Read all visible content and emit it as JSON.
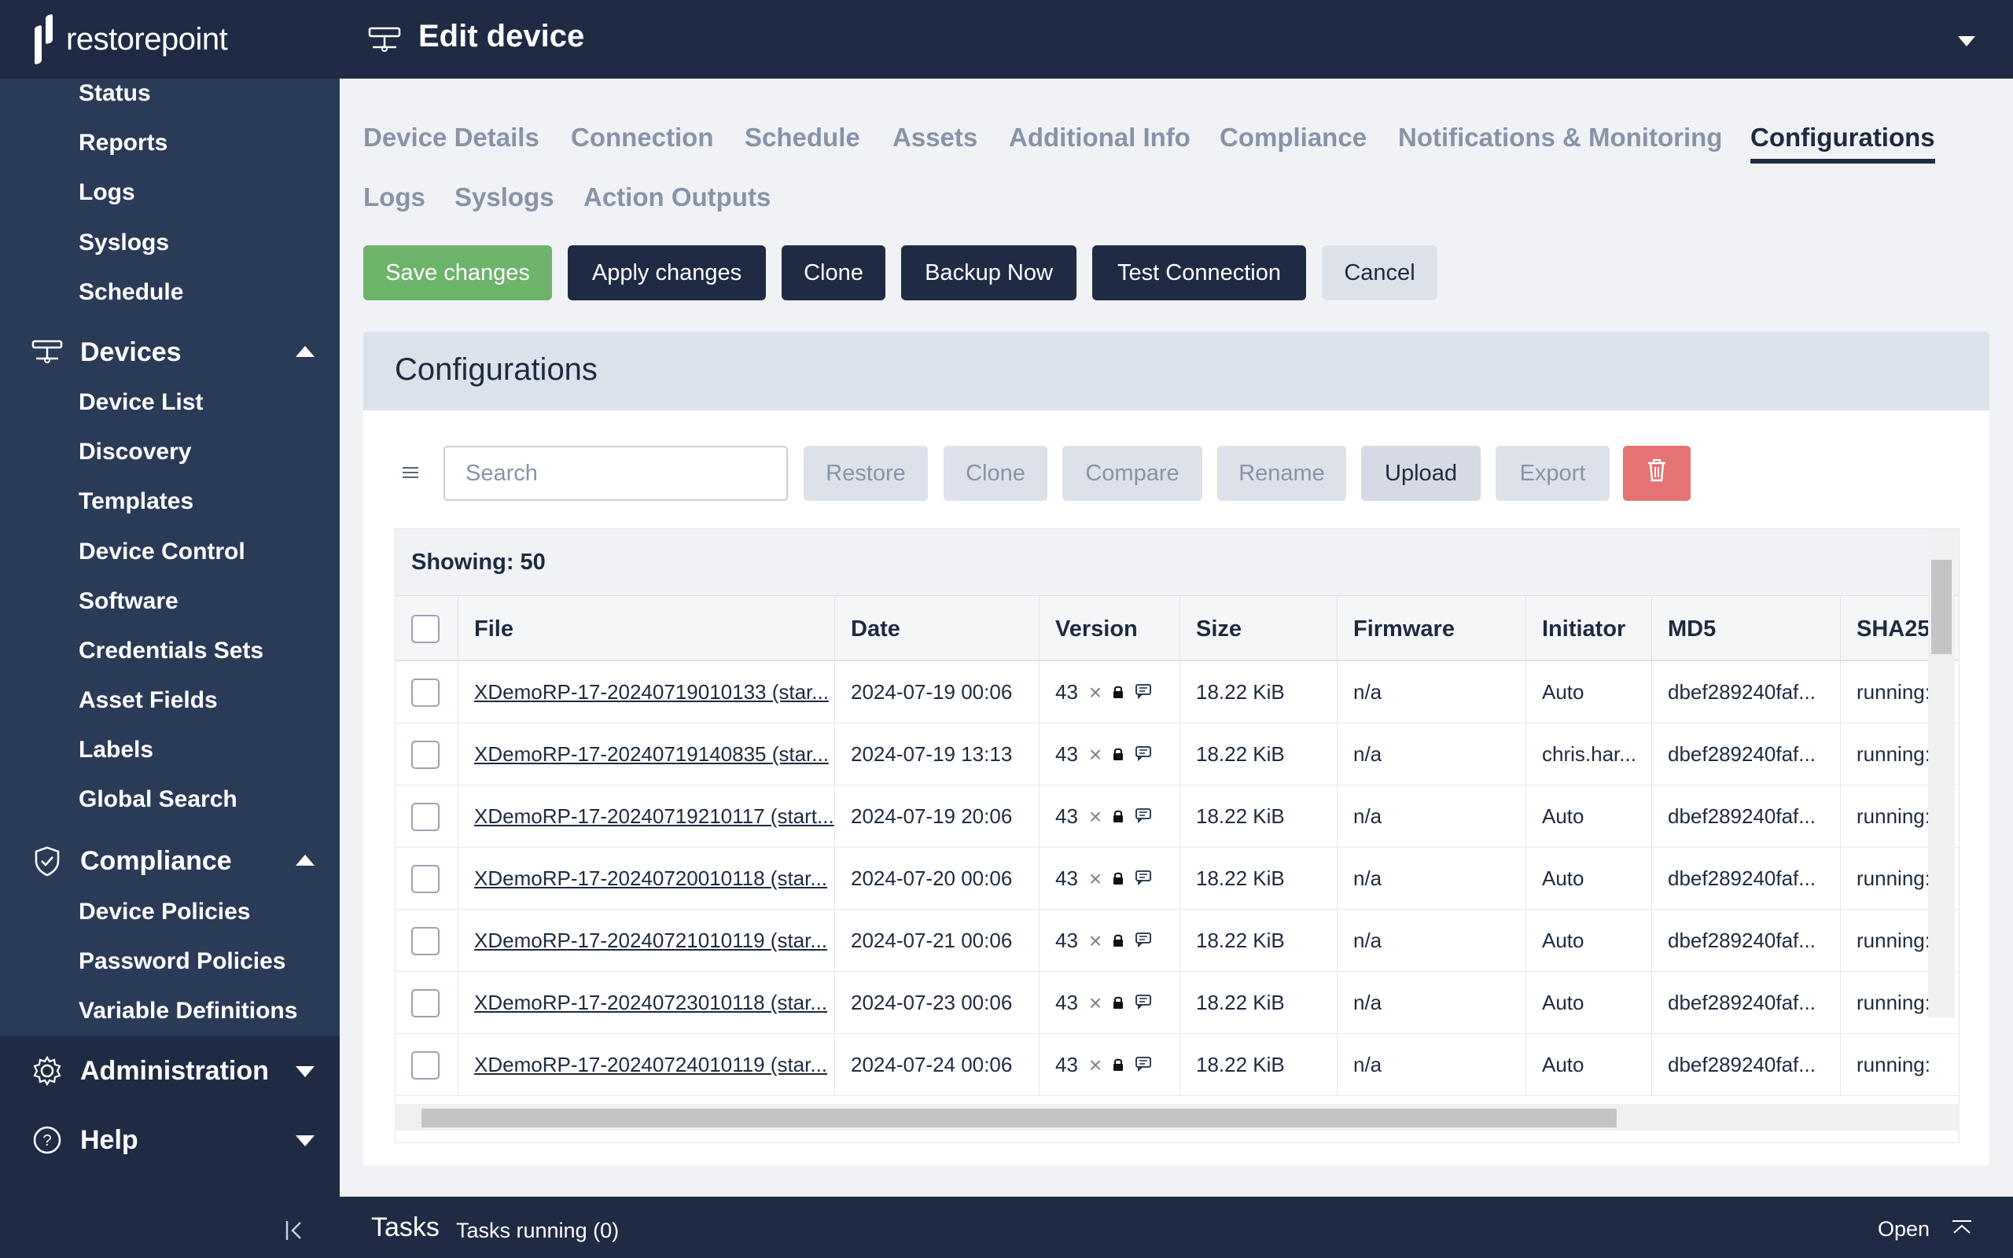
{
  "brand": {
    "name": "restorepoint"
  },
  "sidebar": {
    "top_items": [
      "Status",
      "Reports",
      "Logs",
      "Syslogs",
      "Schedule"
    ],
    "devices": {
      "label": "Devices",
      "items": [
        "Device List",
        "Discovery",
        "Templates",
        "Device Control",
        "Software",
        "Credentials Sets",
        "Asset Fields",
        "Labels",
        "Global Search"
      ]
    },
    "compliance": {
      "label": "Compliance",
      "items": [
        "Device Policies",
        "Password Policies",
        "Variable Definitions"
      ]
    },
    "administration": {
      "label": "Administration"
    },
    "help": {
      "label": "Help"
    }
  },
  "header": {
    "title": "Edit device"
  },
  "tabs": [
    "Device Details",
    "Connection",
    "Schedule",
    "Assets",
    "Additional Info",
    "Compliance",
    "Notifications & Monitoring",
    "Configurations",
    "Logs",
    "Syslogs",
    "Action Outputs"
  ],
  "active_tab": "Configurations",
  "actions": {
    "save": "Save changes",
    "apply": "Apply changes",
    "clone": "Clone",
    "backup": "Backup Now",
    "test": "Test Connection",
    "cancel": "Cancel"
  },
  "panel": {
    "title": "Configurations",
    "search_placeholder": "Search",
    "toolbar": {
      "restore": "Restore",
      "clone": "Clone",
      "compare": "Compare",
      "rename": "Rename",
      "upload": "Upload",
      "export": "Export"
    },
    "showing": "Showing: 50"
  },
  "table": {
    "columns": [
      "File",
      "Date",
      "Version",
      "Size",
      "Firmware",
      "Initiator",
      "MD5",
      "SHA25"
    ],
    "rows": [
      {
        "file": "XDemoRP-17-20240719010133 (star...",
        "date": "2024-07-19 00:06",
        "version": "43",
        "size": "18.22 KiB",
        "firmware": "n/a",
        "initiator": "Auto",
        "md5": "dbef289240faf...",
        "sha": "running:"
      },
      {
        "file": "XDemoRP-17-20240719140835 (star...",
        "date": "2024-07-19 13:13",
        "version": "43",
        "size": "18.22 KiB",
        "firmware": "n/a",
        "initiator": "chris.har...",
        "md5": "dbef289240faf...",
        "sha": "running:"
      },
      {
        "file": "XDemoRP-17-20240719210117 (start...",
        "date": "2024-07-19 20:06",
        "version": "43",
        "size": "18.22 KiB",
        "firmware": "n/a",
        "initiator": "Auto",
        "md5": "dbef289240faf...",
        "sha": "running:"
      },
      {
        "file": "XDemoRP-17-20240720010118 (star...",
        "date": "2024-07-20 00:06",
        "version": "43",
        "size": "18.22 KiB",
        "firmware": "n/a",
        "initiator": "Auto",
        "md5": "dbef289240faf...",
        "sha": "running:"
      },
      {
        "file": "XDemoRP-17-20240721010119 (star...",
        "date": "2024-07-21 00:06",
        "version": "43",
        "size": "18.22 KiB",
        "firmware": "n/a",
        "initiator": "Auto",
        "md5": "dbef289240faf...",
        "sha": "running:"
      },
      {
        "file": "XDemoRP-17-20240723010118 (star...",
        "date": "2024-07-23 00:06",
        "version": "43",
        "size": "18.22 KiB",
        "firmware": "n/a",
        "initiator": "Auto",
        "md5": "dbef289240faf...",
        "sha": "running:"
      },
      {
        "file": "XDemoRP-17-20240724010119 (star...",
        "date": "2024-07-24 00:06",
        "version": "43",
        "size": "18.22 KiB",
        "firmware": "n/a",
        "initiator": "Auto",
        "md5": "dbef289240faf...",
        "sha": "running:"
      }
    ]
  },
  "tasks": {
    "title": "Tasks",
    "running": "Tasks running (0)",
    "open": "Open"
  },
  "colors": {
    "sidebar": "#2a3b58",
    "header": "#1f2b44",
    "save": "#6db36a",
    "delete": "#e57373"
  }
}
